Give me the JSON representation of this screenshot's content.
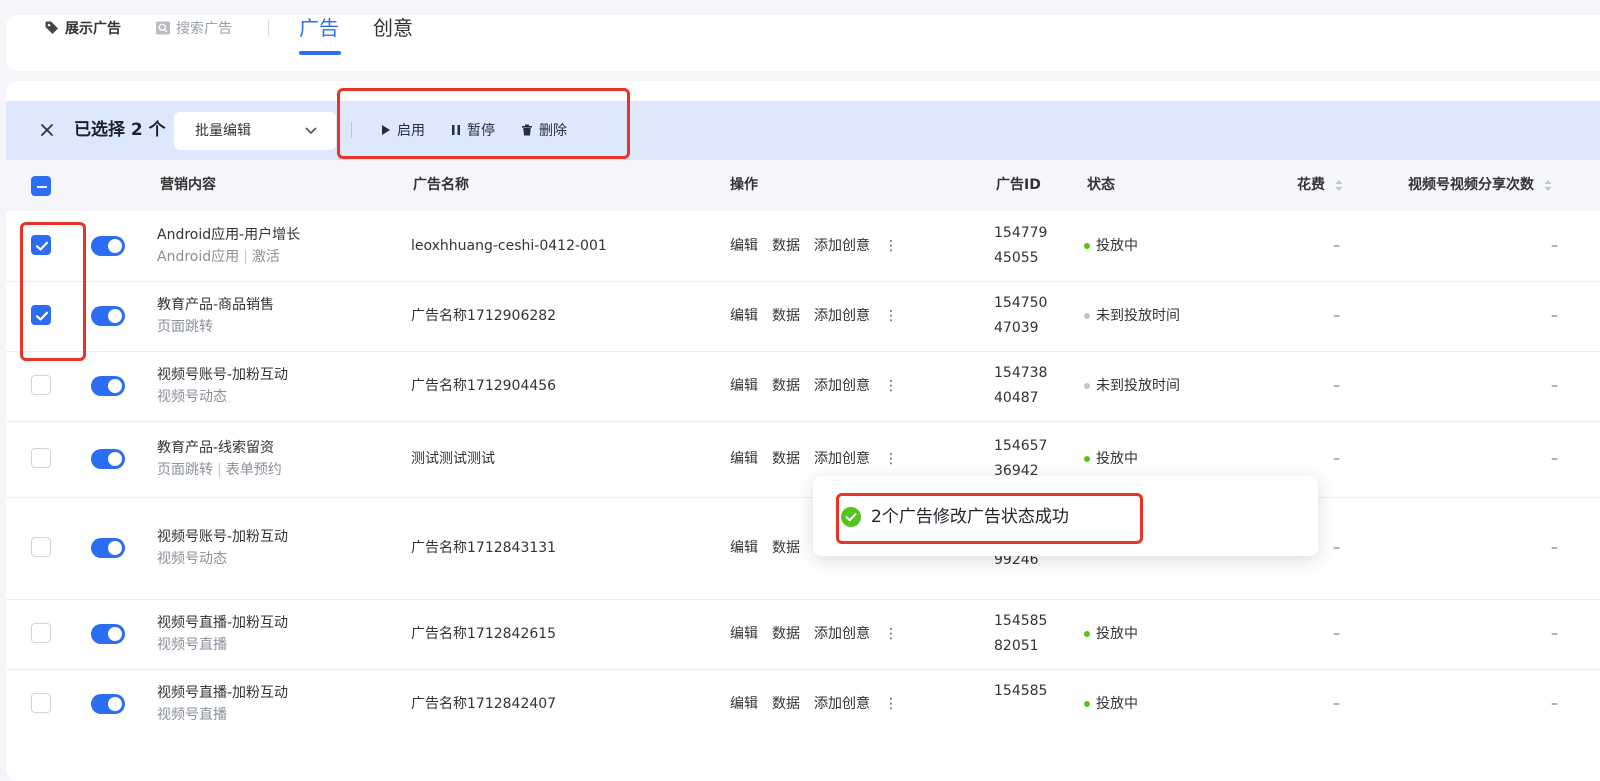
{
  "ad_types": [
    {
      "label": "展示广告",
      "icon": "tag-icon",
      "active": true
    },
    {
      "label": "搜索广告",
      "icon": "search-box-icon",
      "active": false
    }
  ],
  "tabs": [
    {
      "label": "广告",
      "active": true
    },
    {
      "label": "创意",
      "active": false
    }
  ],
  "batch_bar": {
    "selected_label": "已选择 2 个",
    "batch_edit_placeholder": "批量编辑",
    "actions": [
      "启用",
      "暂停",
      "删除"
    ]
  },
  "columns": [
    "营销内容",
    "广告名称",
    "操作",
    "广告ID",
    "状态",
    "花费",
    "视频号视频分享次数"
  ],
  "operations": [
    "编辑",
    "数据",
    "添加创意"
  ],
  "rows": [
    {
      "checked": true,
      "title": "Android应用-用户增长",
      "sub": [
        "Android应用",
        "激活"
      ],
      "name": "leoxhhuang-ceshi-0412-001",
      "id_lines": [
        "154779",
        "45055"
      ],
      "status": "投放中",
      "status_color": "#52c41a",
      "cost": "–",
      "shares": "–"
    },
    {
      "checked": true,
      "title": "教育产品-商品销售",
      "sub": [
        "页面跳转"
      ],
      "name": "广告名称1712906282",
      "id_lines": [
        "154750",
        "47039"
      ],
      "status": "未到投放时间",
      "status_color": "#c0c4cc",
      "cost": "–",
      "shares": "–"
    },
    {
      "checked": false,
      "title": "视频号账号-加粉互动",
      "sub": [
        "视频号动态"
      ],
      "name": "广告名称1712904456",
      "id_lines": [
        "154738",
        "40487"
      ],
      "status": "未到投放时间",
      "status_color": "#c0c4cc",
      "cost": "–",
      "shares": "–"
    },
    {
      "checked": false,
      "title": "教育产品-线索留资",
      "sub": [
        "页面跳转",
        "表单预约"
      ],
      "name": "测试测试测试",
      "id_lines": [
        "154657",
        "36942"
      ],
      "status": "投放中",
      "status_color": "#52c41a",
      "cost": "–",
      "shares": "–"
    },
    {
      "checked": false,
      "title": "视频号账号-加粉互动",
      "sub": [
        "视频号动态"
      ],
      "name": "广告名称1712843131",
      "id_lines": [
        "",
        "99246"
      ],
      "status": "",
      "status_color": "",
      "cost": "–",
      "shares": "–"
    },
    {
      "checked": false,
      "title": "视频号直播-加粉互动",
      "sub": [
        "视频号直播"
      ],
      "name": "广告名称1712842615",
      "id_lines": [
        "154585",
        "82051"
      ],
      "status": "投放中",
      "status_color": "#52c41a",
      "cost": "–",
      "shares": "–"
    },
    {
      "checked": false,
      "title": "视频号直播-加粉互动",
      "sub": [
        "视频号直播"
      ],
      "name": "广告名称1712842407",
      "id_lines": [
        "154585",
        ""
      ],
      "status": "投放中",
      "status_color": "#52c41a",
      "cost": "–",
      "shares": "–"
    }
  ],
  "toast": {
    "message": "2个广告修改广告状态成功",
    "icon": "check-circle-icon",
    "color": "#52c41a"
  },
  "accent_color": "#2b6df3",
  "highlight_color": "#e8332a"
}
